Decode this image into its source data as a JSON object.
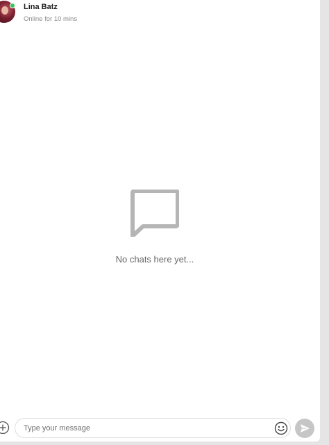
{
  "contact": {
    "name": "Lina Batz",
    "status": "Online for 10 mins",
    "online": true
  },
  "empty_state": {
    "icon": "chat-bubble-icon",
    "text": "No chats here yet..."
  },
  "composer": {
    "placeholder": "Type your message",
    "value": "",
    "add_icon": "plus-circle-icon",
    "emoji_icon": "smiley-icon",
    "send_icon": "send-icon"
  },
  "colors": {
    "online": "#34c759",
    "icon_gray": "#b5b5b5",
    "send_bg": "#c6c6c6"
  }
}
